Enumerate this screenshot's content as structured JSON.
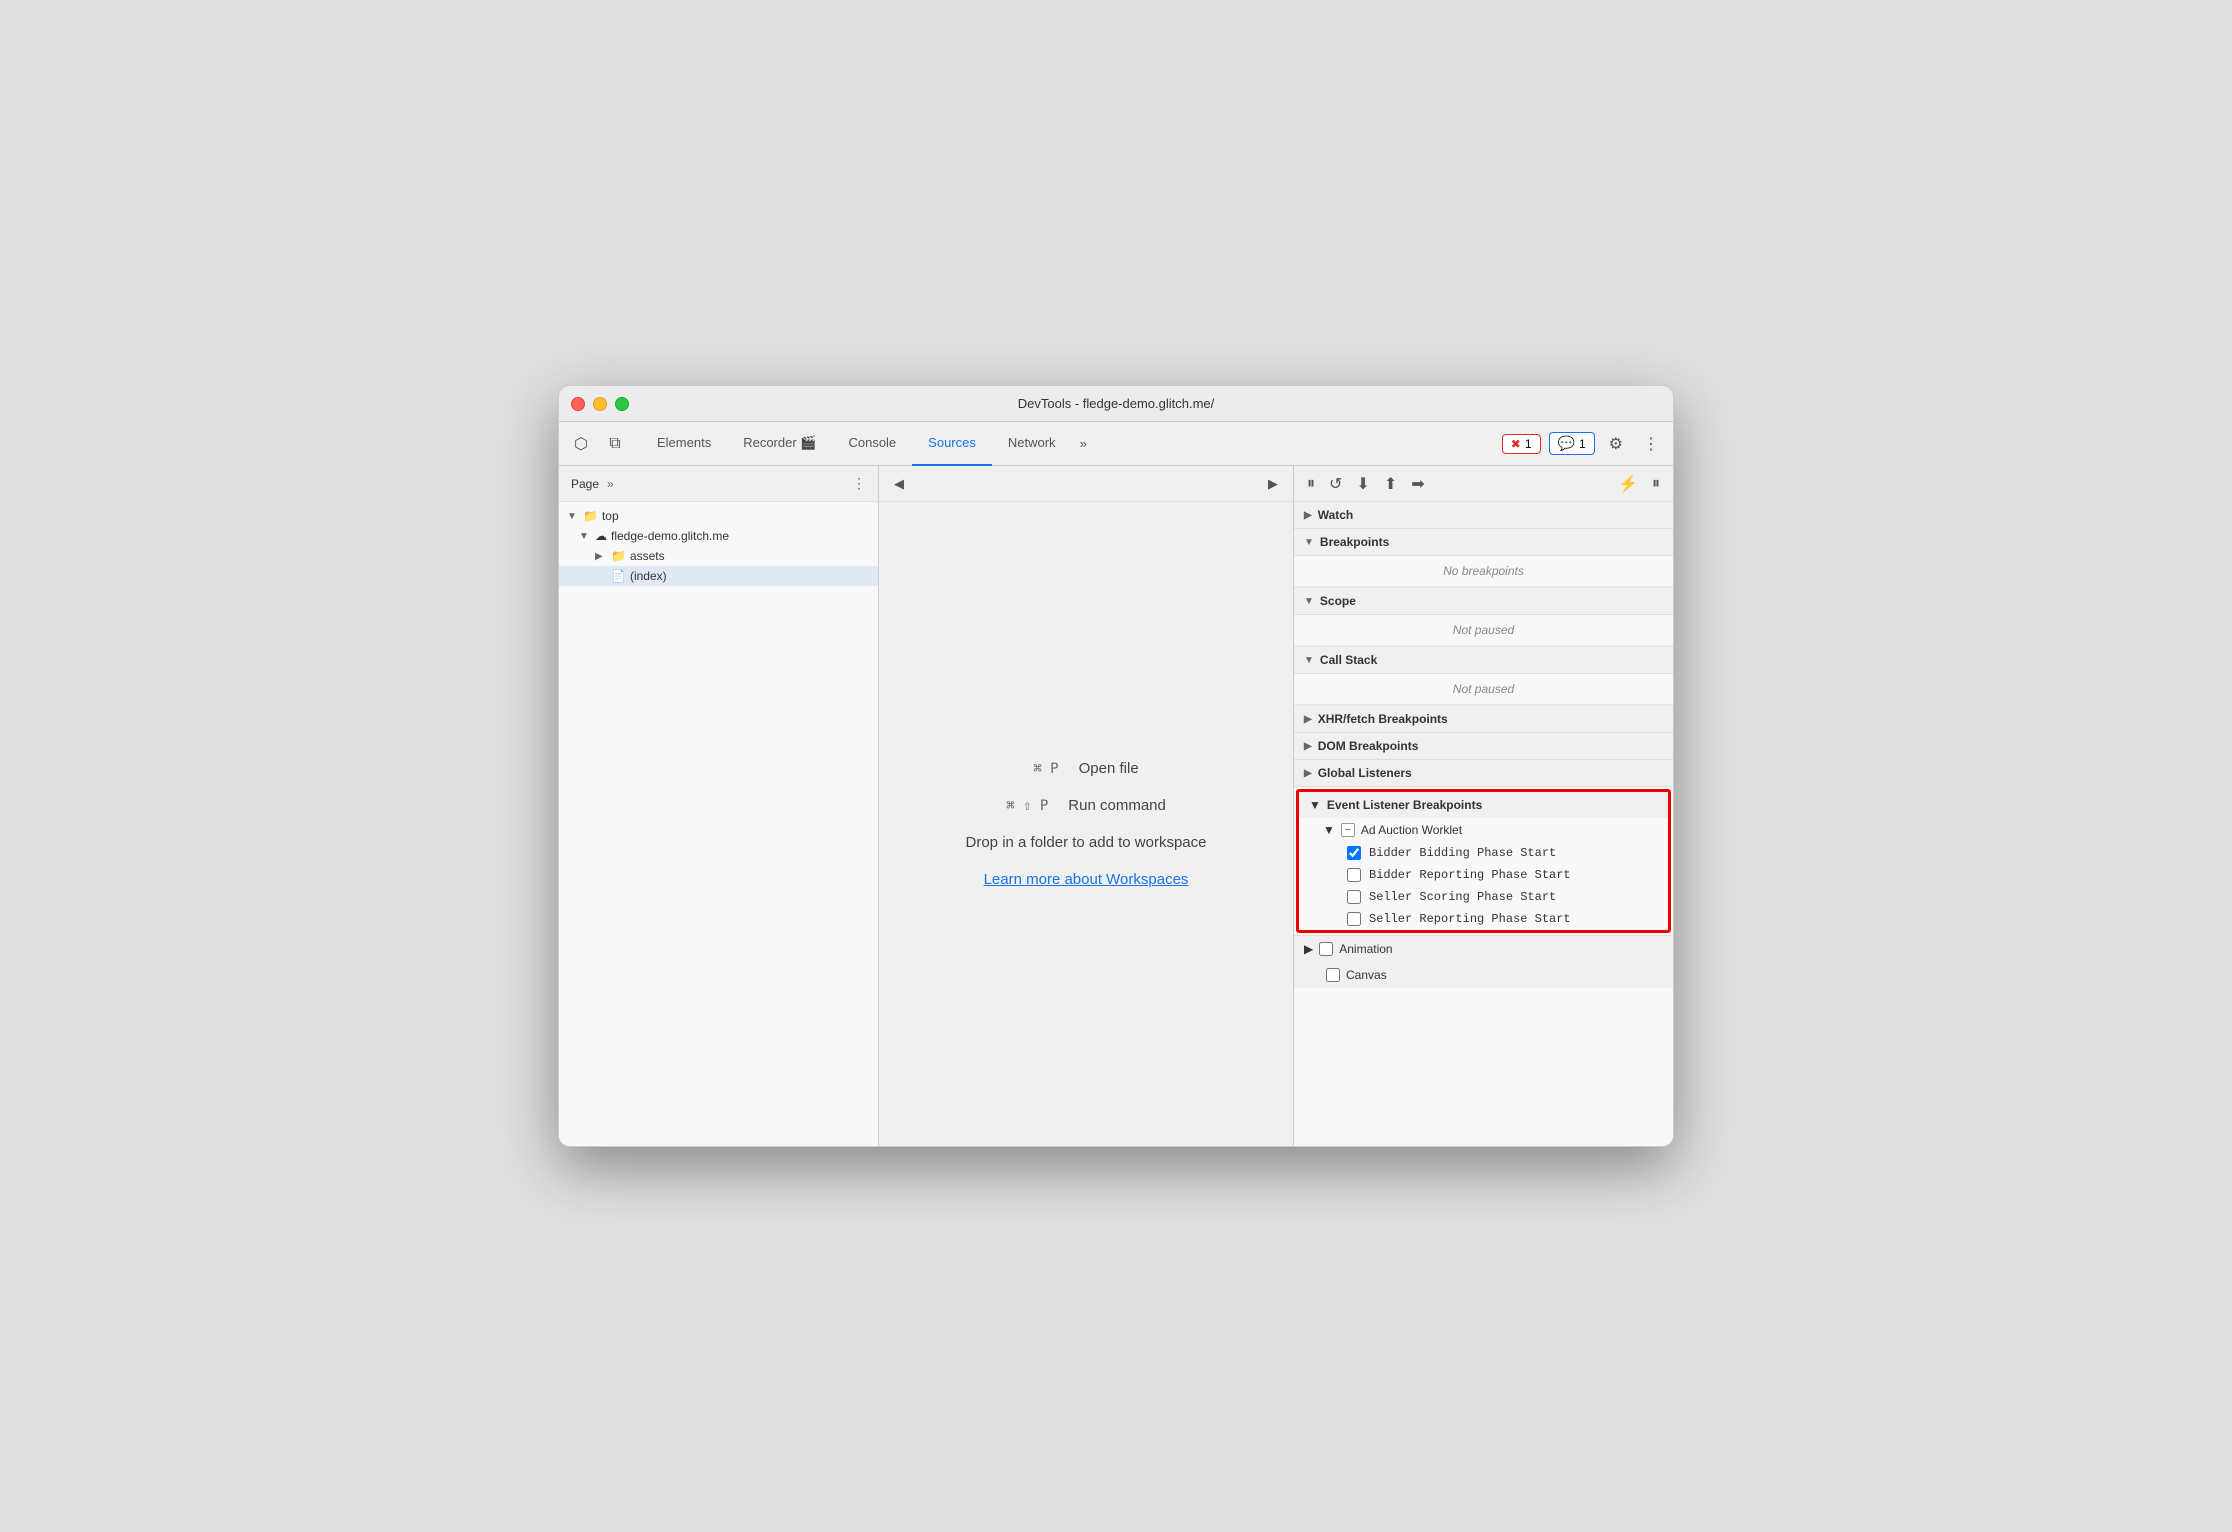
{
  "titlebar": {
    "title": "DevTools - fledge-demo.glitch.me/"
  },
  "tabs": {
    "items": [
      {
        "label": "Elements",
        "active": false
      },
      {
        "label": "Recorder 🎬",
        "active": false
      },
      {
        "label": "Console",
        "active": false
      },
      {
        "label": "Sources",
        "active": true
      },
      {
        "label": "Network",
        "active": false
      }
    ],
    "more_label": "»",
    "error_count": "1",
    "info_count": "1"
  },
  "left_panel": {
    "tab_label": "Page",
    "tab_more": "»",
    "tree": [
      {
        "label": "top",
        "level": 0,
        "type": "folder",
        "expanded": true,
        "arrow": "▼"
      },
      {
        "label": "fledge-demo.glitch.me",
        "level": 1,
        "type": "cloud",
        "expanded": true,
        "arrow": "▼"
      },
      {
        "label": "assets",
        "level": 2,
        "type": "folder",
        "expanded": false,
        "arrow": "▶"
      },
      {
        "label": "(index)",
        "level": 2,
        "type": "file",
        "selected": true
      }
    ]
  },
  "middle_panel": {
    "shortcuts": [
      {
        "key": "⌘ P",
        "label": "Open file"
      },
      {
        "key": "⌘ ⇧ P",
        "label": "Run command"
      }
    ],
    "drop_text": "Drop in a folder to add to workspace",
    "workspace_link": "Learn more about Workspaces"
  },
  "right_panel": {
    "sections": [
      {
        "id": "watch",
        "label": "Watch",
        "arrow": "▶",
        "collapsed": true
      },
      {
        "id": "breakpoints",
        "label": "Breakpoints",
        "arrow": "▼",
        "body": "No breakpoints"
      },
      {
        "id": "scope",
        "label": "Scope",
        "arrow": "▼",
        "body": "Not paused"
      },
      {
        "id": "call-stack",
        "label": "Call Stack",
        "arrow": "▼",
        "body": "Not paused"
      },
      {
        "id": "xhr-fetch",
        "label": "XHR/fetch Breakpoints",
        "arrow": "▶",
        "collapsed": true
      },
      {
        "id": "dom-breakpoints",
        "label": "DOM Breakpoints",
        "arrow": "▶",
        "collapsed": true
      },
      {
        "id": "global-listeners",
        "label": "Global Listeners",
        "arrow": "▶",
        "collapsed": true
      }
    ],
    "event_listener": {
      "label": "Event Listener Breakpoints",
      "arrow": "▼",
      "sub_group": {
        "label": "Ad Auction Worklet",
        "arrow": "▼",
        "items": [
          {
            "label": "Bidder Bidding Phase Start",
            "checked": true
          },
          {
            "label": "Bidder Reporting Phase Start",
            "checked": false
          },
          {
            "label": "Seller Scoring Phase Start",
            "checked": false
          },
          {
            "label": "Seller Reporting Phase Start",
            "checked": false
          }
        ]
      }
    },
    "animation_section": {
      "label": "Animation",
      "arrow": "▶"
    },
    "canvas_section": {
      "label": "Canvas",
      "arrow": ""
    }
  },
  "debug_toolbar": {
    "pause": "⏸",
    "step_over": "↺",
    "step_into": "↓",
    "step_out": "↑",
    "step": "→",
    "deactivate": "⚡",
    "stop": "⏹"
  }
}
